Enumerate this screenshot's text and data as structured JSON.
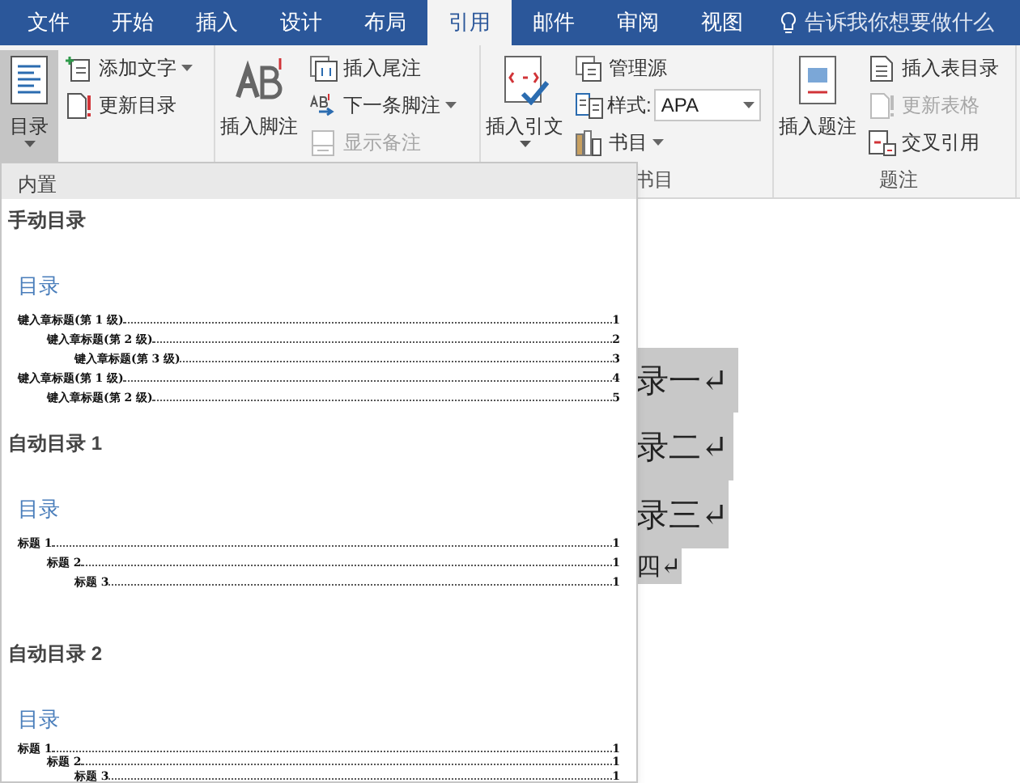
{
  "tabs": [
    {
      "label": "文件",
      "selected": false
    },
    {
      "label": "开始",
      "selected": false
    },
    {
      "label": "插入",
      "selected": false
    },
    {
      "label": "设计",
      "selected": false
    },
    {
      "label": "布局",
      "selected": false
    },
    {
      "label": "引用",
      "selected": true
    },
    {
      "label": "邮件",
      "selected": false
    },
    {
      "label": "审阅",
      "selected": false
    },
    {
      "label": "视图",
      "selected": false
    }
  ],
  "tell_me": "告诉我你想要做什么",
  "ribbon": [
    {
      "large": {
        "label": "目录",
        "dropdown": true,
        "selected": true
      },
      "small": [
        {
          "label": "添加文字",
          "dropdown": true,
          "disabled": false
        },
        {
          "label": "更新目录",
          "dropdown": false,
          "disabled": false
        }
      ]
    },
    {
      "large": {
        "label": "插入脚注",
        "dropdown": false,
        "selected": false
      },
      "small": [
        {
          "label": "插入尾注",
          "dropdown": false,
          "disabled": false
        },
        {
          "label": "下一条脚注",
          "dropdown": true,
          "disabled": false
        },
        {
          "label": "显示备注",
          "dropdown": false,
          "disabled": true
        }
      ]
    },
    {
      "label": "书目",
      "large": {
        "label": "插入引文",
        "dropdown": true,
        "selected": false
      },
      "small": [
        {
          "label": "管理源",
          "dropdown": false,
          "disabled": false
        },
        {
          "kind": "combo",
          "label": "样式:",
          "value": "APA",
          "disabled": false
        },
        {
          "label": "书目",
          "dropdown": true,
          "disabled": false
        }
      ]
    },
    {
      "label": "题注",
      "large": {
        "label": "插入题注",
        "dropdown": false,
        "selected": false
      },
      "small": [
        {
          "label": "插入表目录",
          "dropdown": false,
          "disabled": false
        },
        {
          "label": "更新表格",
          "dropdown": false,
          "disabled": true
        },
        {
          "label": "交叉引用",
          "dropdown": false,
          "disabled": false
        }
      ]
    }
  ],
  "document": {
    "lines": [
      "录一↵",
      "录二↵",
      "录三↵",
      "四↵"
    ]
  },
  "toc_gallery": {
    "header": "内置",
    "items": [
      {
        "title": "手动目录",
        "heading": "目录",
        "entries": [
          {
            "text": "键入章标题(第 1 级)",
            "page": "1",
            "children": [
              {
                "text": "键入章标题(第 2 级)",
                "page": "2",
                "children": [
                  {
                    "text": "键入章标题(第 3 级)",
                    "page": "3"
                  }
                ]
              }
            ]
          },
          {
            "text": "键入章标题(第 1 级)",
            "page": "4",
            "children": [
              {
                "text": "键入章标题(第 2 级)",
                "page": "5"
              }
            ]
          }
        ]
      },
      {
        "title": "自动目录 1",
        "heading": "目录",
        "entries": [
          {
            "text": "标题 1",
            "page": "1",
            "children": [
              {
                "text": "标题 2",
                "page": "1",
                "children": [
                  {
                    "text": "标题 3",
                    "page": "1"
                  }
                ]
              }
            ]
          }
        ]
      },
      {
        "title": "自动目录 2",
        "heading": "目录",
        "entries": [
          {
            "text": "标题 1",
            "page": "1",
            "children": [
              {
                "text": "标题 2",
                "page": "1",
                "children": [
                  {
                    "text": "标题 3",
                    "page": "1"
                  }
                ]
              }
            ]
          }
        ]
      }
    ]
  }
}
